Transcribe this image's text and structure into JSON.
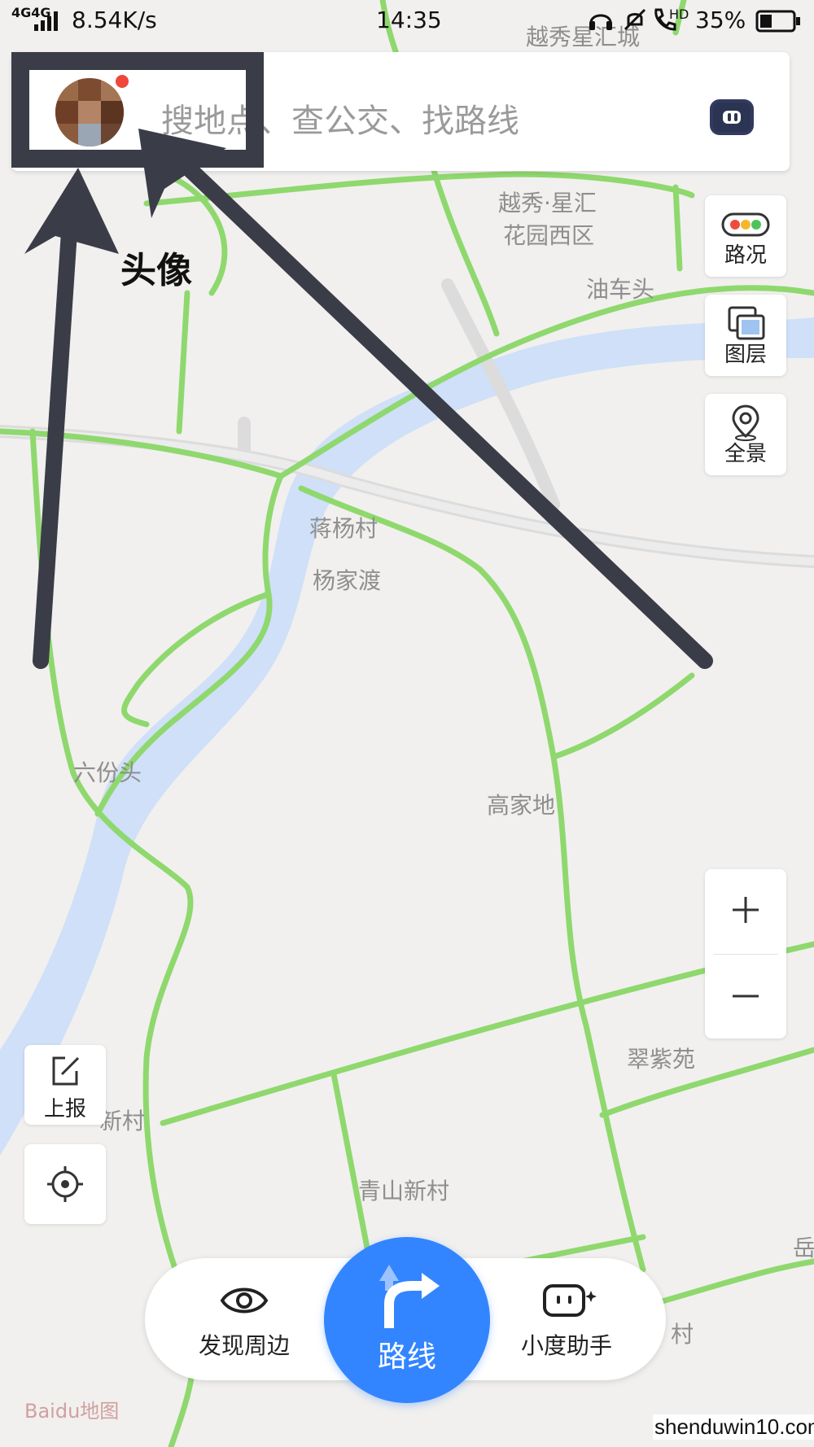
{
  "status_bar": {
    "network": "4G4G",
    "speed": "8.54K/s",
    "time": "14:35",
    "battery": "35%",
    "hd": "HD"
  },
  "search": {
    "placeholder": "搜地点、查公交、找路线"
  },
  "annotation": {
    "label": "头像"
  },
  "side_buttons": {
    "traffic": "路况",
    "layers": "图层",
    "panorama": "全景"
  },
  "left_buttons": {
    "report": "上报"
  },
  "bottom_bar": {
    "discover": "发现周边",
    "route": "路线",
    "assistant": "小度助手"
  },
  "map_labels": {
    "yuexiu_xinghui_cheng": "越秀星汇城",
    "yuexiu_xinghui_west_1": "越秀·星汇",
    "yuexiu_xinghui_west_2": "花园西区",
    "youchetou": "油车头",
    "jiangyangcun": "蒋杨村",
    "yangjiadu": "杨家渡",
    "liufentou": "六份头",
    "gaojiadi": "高家地",
    "cuiziyuan": "翠紫苑",
    "xincun": "新村",
    "qingshan_xincun": "青山新村",
    "cun": "村",
    "yue": "岳"
  },
  "branding": {
    "baidu": "Baidu地图",
    "watermark": "shenduwin10.com"
  },
  "colors": {
    "road_green": "#8fd86e",
    "river_blue": "#cfe0f8",
    "route_blue": "#3385ff",
    "annotation_dark": "#3a3d47"
  }
}
